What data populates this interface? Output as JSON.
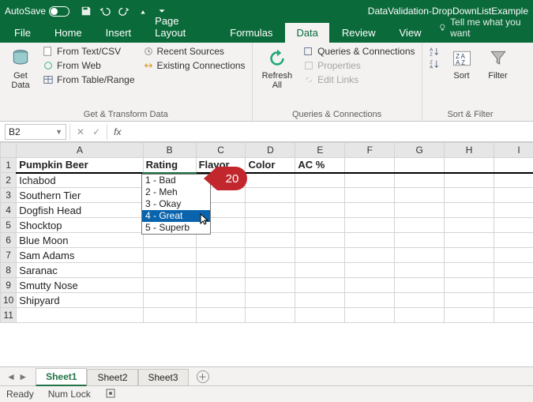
{
  "titlebar": {
    "autosave": "AutoSave",
    "doc": "DataValidation-DropDownListExample"
  },
  "tabs": {
    "file": "File",
    "home": "Home",
    "insert": "Insert",
    "pagelayout": "Page Layout",
    "formulas": "Formulas",
    "data": "Data",
    "review": "Review",
    "view": "View",
    "tellme": "Tell me what you want"
  },
  "ribbon": {
    "getdata": "Get\nData",
    "fromtxt": "From Text/CSV",
    "fromweb": "From Web",
    "fromtable": "From Table/Range",
    "recent": "Recent Sources",
    "existing": "Existing Connections",
    "group1": "Get & Transform Data",
    "refresh": "Refresh\nAll",
    "queries": "Queries & Connections",
    "props": "Properties",
    "editlinks": "Edit Links",
    "group2": "Queries & Connections",
    "sort": "Sort",
    "filter": "Filter",
    "group3": "Sort & Filter"
  },
  "fbar": {
    "name": "B2",
    "fx": "fx"
  },
  "columns": [
    "A",
    "B",
    "C",
    "D",
    "E",
    "F",
    "G",
    "H",
    "I"
  ],
  "headers": {
    "a": "Pumpkin Beer",
    "b": "Rating",
    "c": "Flavor",
    "d": "Color",
    "e": "AC %"
  },
  "rows": [
    "Ichabod",
    "Southern Tier",
    "Dogfish Head",
    "Shocktop",
    "Blue Moon",
    "Sam Adams",
    "Saranac",
    "Smutty Nose",
    "Shipyard"
  ],
  "dropdown": [
    "1 - Bad",
    "2 - Meh",
    "3 - Okay",
    "4 - Great",
    "5 - Superb"
  ],
  "dropdown_selected": 3,
  "callout": "20",
  "sheets": {
    "s1": "Sheet1",
    "s2": "Sheet2",
    "s3": "Sheet3"
  },
  "status": {
    "ready": "Ready",
    "numlock": "Num Lock"
  }
}
